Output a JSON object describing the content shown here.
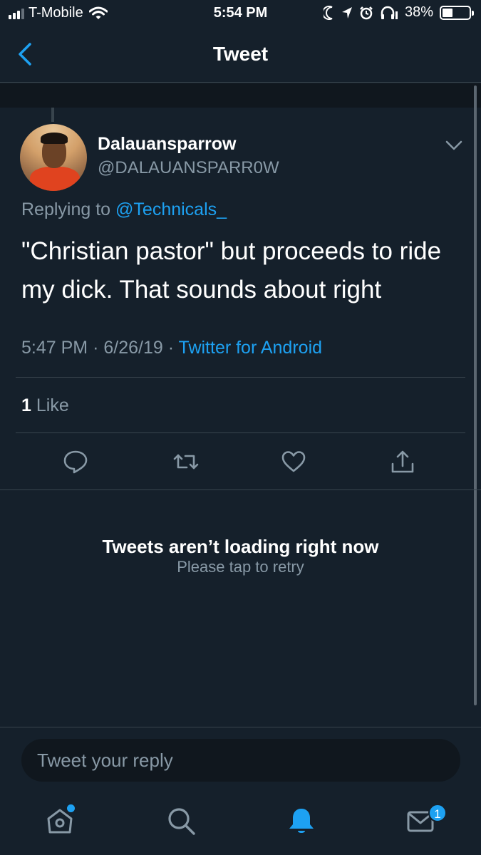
{
  "status_bar": {
    "carrier": "T-Mobile",
    "time": "5:54 PM",
    "battery": "38%",
    "battery_level": 0.38,
    "icons": [
      "signal-bars-icon",
      "wifi-icon",
      "moon-icon",
      "location-arrow-icon",
      "alarm-icon",
      "headphones-icon",
      "battery-icon"
    ]
  },
  "nav": {
    "title": "Tweet",
    "back_icon": "chevron-left-icon"
  },
  "tweet": {
    "display_name": "Dalauansparrow",
    "handle": "@DALAUANSPARR0W",
    "replying_prefix": "Replying to",
    "replying_to": "@Technicals_",
    "text": "\"Christian pastor\" but proceeds to ride my dick. That sounds about right",
    "time": "5:47 PM",
    "date": "6/26/19",
    "source": "Twitter for Android",
    "like_count": "1",
    "like_label": "Like"
  },
  "actions": [
    "reply-icon",
    "retweet-icon",
    "like-icon",
    "share-icon"
  ],
  "empty_state": {
    "title": "Tweets aren’t loading right now",
    "subtitle": "Please tap to retry"
  },
  "composer": {
    "placeholder": "Tweet your reply"
  },
  "tab_bar": {
    "items": [
      "home-icon",
      "search-icon",
      "notifications-icon",
      "messages-icon"
    ],
    "messages_badge": "1"
  },
  "colors": {
    "background": "#15202b",
    "accent": "#1da1f2",
    "secondary_text": "#8899a6",
    "divider": "#38444d"
  }
}
